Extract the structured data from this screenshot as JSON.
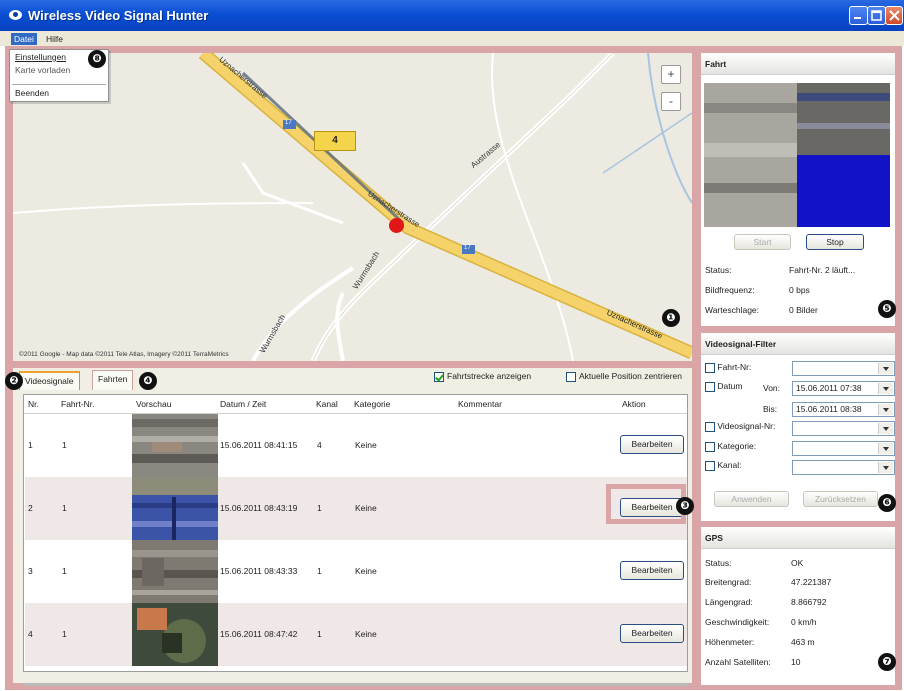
{
  "window": {
    "title": "Wireless Video Signal Hunter"
  },
  "menu": {
    "file": "Datei",
    "help": "Hilfe",
    "dropdown": {
      "settings": "Einstellungen",
      "load_map": "Karte vorladen",
      "quit": "Beenden"
    }
  },
  "map": {
    "zoom_in": "+",
    "zoom_out": "-",
    "marker_label": "4",
    "copyright": "©2011 Google - Map data ©2011 Tele Atlas, Imagery ©2011 TerraMetrics",
    "streets": [
      "Uznacherstrasse",
      "Uznacherstrasse",
      "Austrasse",
      "Wurmsbach",
      "Wurmsbach",
      "Uznacherstrasse"
    ],
    "road_numbers": [
      "17",
      "17"
    ]
  },
  "tabs": {
    "videosignale": "Videosignale",
    "fahrten": "Fahrten",
    "show_route": "Fahrtstrecke anzeigen",
    "show_route_checked": true,
    "center_position": "Aktuelle Position zentrieren",
    "center_position_checked": false
  },
  "table": {
    "headers": [
      "Nr.",
      "Fahrt-Nr.",
      "Vorschau",
      "Datum / Zeit",
      "Kanal",
      "Kategorie",
      "Kommentar",
      "Aktion"
    ],
    "rows": [
      {
        "nr": "1",
        "fahrt": "1",
        "datetime": "15.06.2011 08:41:15",
        "kanal": "4",
        "kategorie": "Keine",
        "kommentar": "",
        "action": "Bearbeiten"
      },
      {
        "nr": "2",
        "fahrt": "1",
        "datetime": "15.06.2011 08:43:19",
        "kanal": "1",
        "kategorie": "Keine",
        "kommentar": "",
        "action": "Bearbeiten"
      },
      {
        "nr": "3",
        "fahrt": "1",
        "datetime": "15.06.2011 08:43:33",
        "kanal": "1",
        "kategorie": "Keine",
        "kommentar": "",
        "action": "Bearbeiten"
      },
      {
        "nr": "4",
        "fahrt": "1",
        "datetime": "15.06.2011 08:47:42",
        "kanal": "1",
        "kategorie": "Keine",
        "kommentar": "",
        "action": "Bearbeiten"
      }
    ]
  },
  "fahrt": {
    "title": "Fahrt",
    "start": "Start",
    "stop": "Stop",
    "status_label": "Status:",
    "status_value": "Fahrt-Nr. 2 läuft...",
    "fps_label": "Bildfrequenz:",
    "fps_value": "0 bps",
    "queue_label": "Warteschlage:",
    "queue_value": "0 Bilder"
  },
  "filter": {
    "title": "Videosignal-Filter",
    "fahrt_nr": "Fahrt-Nr:",
    "datum": "Datum",
    "von": "Von:",
    "von_value": "15.06.2011 07:38",
    "bis": "Bis:",
    "bis_value": "15.06.2011 08:38",
    "videosignal_nr": "Videosignal-Nr:",
    "kategorie": "Kategorie:",
    "kanal": "Kanal:",
    "apply": "Anwenden",
    "reset": "Zurücksetzen"
  },
  "gps": {
    "title": "GPS",
    "rows": [
      {
        "label": "Status:",
        "value": "OK"
      },
      {
        "label": "Breitengrad:",
        "value": "47.221387"
      },
      {
        "label": "Längengrad:",
        "value": "8.866792"
      },
      {
        "label": "Geschwindigkeit:",
        "value": "0 km/h"
      },
      {
        "label": "Höhenmeter:",
        "value": "463 m"
      },
      {
        "label": "Anzahl Satelliten:",
        "value": "10"
      }
    ]
  },
  "callouts": [
    "❶",
    "❷",
    "❸",
    "❹",
    "❺",
    "❻",
    "❼",
    "❽"
  ],
  "colors": {
    "titlebar": "#0a4fd4",
    "highlight_frame": "#d9a5a6",
    "road_yellow": "#f5d36a",
    "marker_red": "#e21616"
  }
}
